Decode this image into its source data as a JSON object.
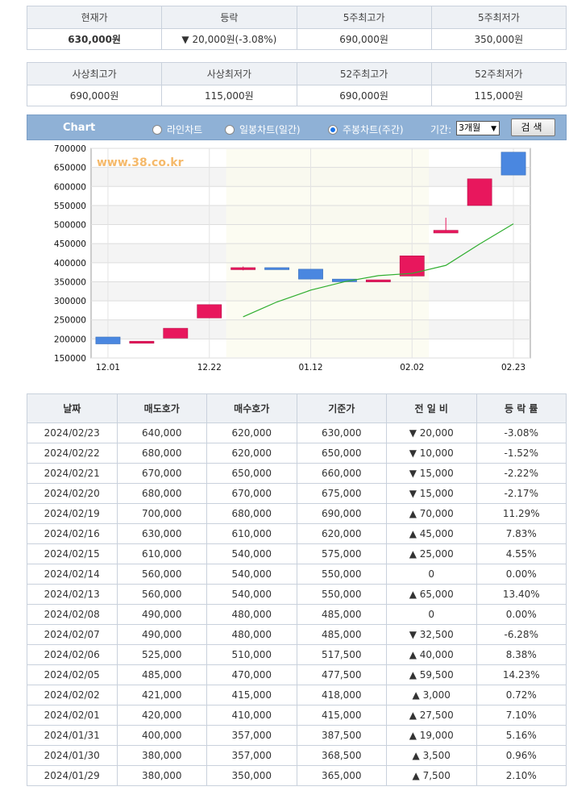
{
  "summary1": {
    "headers": [
      "현재가",
      "등락",
      "5주최고가",
      "5주최저가"
    ],
    "current_price": "630,000원",
    "change": "20,000원(-3.08%)",
    "change_arrow": "▼",
    "high_5w": "690,000원",
    "low_5w": "350,000원"
  },
  "summary2": {
    "headers": [
      "사상최고가",
      "사상최저가",
      "52주최고가",
      "52주최저가"
    ],
    "values": [
      "690,000원",
      "115,000원",
      "690,000원",
      "115,000원"
    ]
  },
  "chart_controls": {
    "title": "Chart",
    "radio_line": "라인차트",
    "radio_daily": "일봉차트(일간)",
    "radio_weekly": "주봉차트(주간)",
    "selected": "weekly",
    "period_label": "기간:",
    "period_value": "3개월",
    "search_label": "검색"
  },
  "chart_data": {
    "type": "candlestick",
    "watermark": "www.38.co.kr",
    "ylim": [
      150000,
      700000
    ],
    "y_ticks": [
      "700000",
      "650000",
      "600000",
      "550000",
      "500000",
      "450000",
      "400000",
      "350000",
      "300000",
      "250000",
      "200000",
      "150000"
    ],
    "y_tick_values": [
      700000,
      650000,
      600000,
      550000,
      500000,
      450000,
      400000,
      350000,
      300000,
      250000,
      200000,
      150000
    ],
    "x_ticks": [
      "12.01",
      "12.22",
      "01.12",
      "02.02",
      "02.23"
    ],
    "x_tick_index": [
      0,
      3,
      6,
      9,
      12
    ],
    "candles": [
      {
        "open": 205000,
        "close": 187000,
        "high": 205000,
        "low": 187000
      },
      {
        "open": 190000,
        "close": 194000,
        "high": 194000,
        "low": 190000
      },
      {
        "open": 202000,
        "close": 228000,
        "high": 228000,
        "low": 202000
      },
      {
        "open": 255000,
        "close": 290000,
        "high": 290000,
        "low": 255000
      },
      {
        "open": 382000,
        "close": 387000,
        "high": 390000,
        "low": 380000
      },
      {
        "open": 387000,
        "close": 382000,
        "high": 387000,
        "low": 382000
      },
      {
        "open": 383000,
        "close": 357000,
        "high": 383000,
        "low": 357000
      },
      {
        "open": 357000,
        "close": 350000,
        "high": 357000,
        "low": 350000
      },
      {
        "open": 350000,
        "close": 355000,
        "high": 355000,
        "low": 350000
      },
      {
        "open": 365000,
        "close": 418000,
        "high": 418000,
        "low": 365000
      },
      {
        "open": 478000,
        "close": 485000,
        "high": 518000,
        "low": 478000
      },
      {
        "open": 550000,
        "close": 620000,
        "high": 620000,
        "low": 550000
      },
      {
        "open": 690000,
        "close": 630000,
        "high": 690000,
        "low": 630000
      }
    ],
    "ma_line": [
      {
        "i": 4,
        "v": 258000
      },
      {
        "i": 5,
        "v": 297000
      },
      {
        "i": 6,
        "v": 328000
      },
      {
        "i": 7,
        "v": 350000
      },
      {
        "i": 8,
        "v": 366000
      },
      {
        "i": 9,
        "v": 372000
      },
      {
        "i": 10,
        "v": 393000
      },
      {
        "i": 11,
        "v": 449000
      },
      {
        "i": 12,
        "v": 502000
      }
    ],
    "colors": {
      "up": "#e8175d",
      "down": "#4a87e0",
      "ma": "#2fae2f"
    }
  },
  "history": {
    "headers": [
      "날짜",
      "매도호가",
      "매수호가",
      "기준가",
      "전 일 비",
      "등 락 률"
    ],
    "rows": [
      [
        "2024/02/23",
        "640,000",
        "620,000",
        "630,000",
        "▼ 20,000",
        "-3.08%"
      ],
      [
        "2024/02/22",
        "680,000",
        "620,000",
        "650,000",
        "▼ 10,000",
        "-1.52%"
      ],
      [
        "2024/02/21",
        "670,000",
        "650,000",
        "660,000",
        "▼ 15,000",
        "-2.22%"
      ],
      [
        "2024/02/20",
        "680,000",
        "670,000",
        "675,000",
        "▼ 15,000",
        "-2.17%"
      ],
      [
        "2024/02/19",
        "700,000",
        "680,000",
        "690,000",
        "▲ 70,000",
        "11.29%"
      ],
      [
        "2024/02/16",
        "630,000",
        "610,000",
        "620,000",
        "▲ 45,000",
        "7.83%"
      ],
      [
        "2024/02/15",
        "610,000",
        "540,000",
        "575,000",
        "▲ 25,000",
        "4.55%"
      ],
      [
        "2024/02/14",
        "560,000",
        "540,000",
        "550,000",
        "0",
        "0.00%"
      ],
      [
        "2024/02/13",
        "560,000",
        "540,000",
        "550,000",
        "▲ 65,000",
        "13.40%"
      ],
      [
        "2024/02/08",
        "490,000",
        "480,000",
        "485,000",
        "0",
        "0.00%"
      ],
      [
        "2024/02/07",
        "490,000",
        "480,000",
        "485,000",
        "▼ 32,500",
        "-6.28%"
      ],
      [
        "2024/02/06",
        "525,000",
        "510,000",
        "517,500",
        "▲ 40,000",
        "8.38%"
      ],
      [
        "2024/02/05",
        "485,000",
        "470,000",
        "477,500",
        "▲ 59,500",
        "14.23%"
      ],
      [
        "2024/02/02",
        "421,000",
        "415,000",
        "418,000",
        "▲ 3,000",
        "0.72%"
      ],
      [
        "2024/02/01",
        "420,000",
        "410,000",
        "415,000",
        "▲ 27,500",
        "7.10%"
      ],
      [
        "2024/01/31",
        "400,000",
        "357,000",
        "387,500",
        "▲ 19,000",
        "5.16%"
      ],
      [
        "2024/01/30",
        "380,000",
        "357,000",
        "368,500",
        "▲ 3,500",
        "0.96%"
      ],
      [
        "2024/01/29",
        "380,000",
        "350,000",
        "365,000",
        "▲ 7,500",
        "2.10%"
      ]
    ]
  }
}
